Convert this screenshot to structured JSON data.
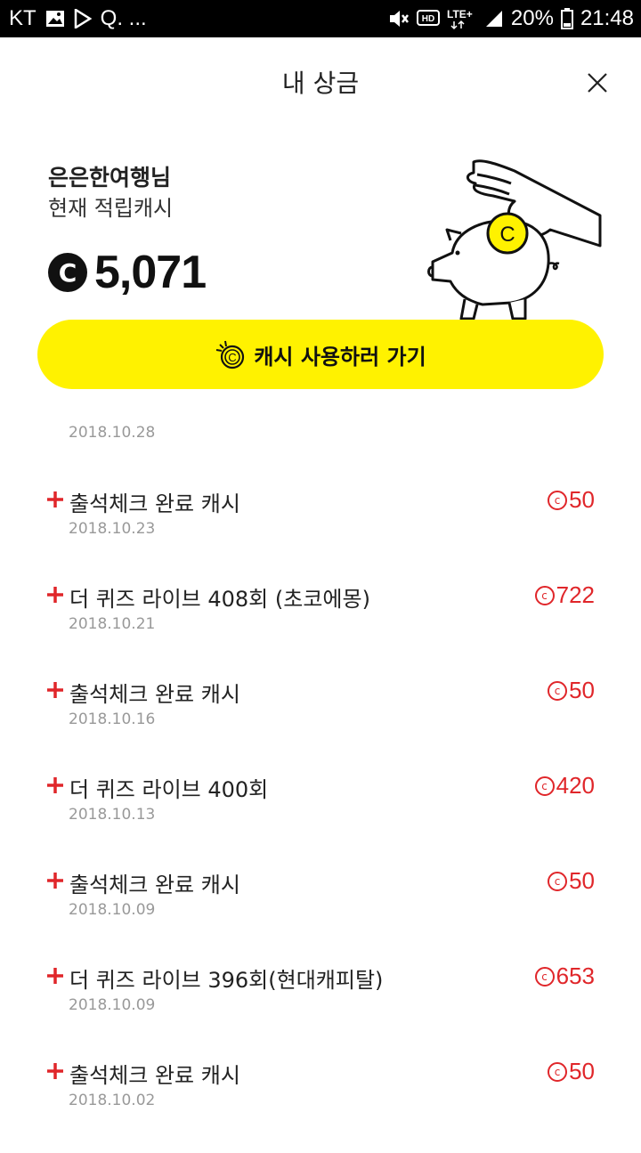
{
  "status_bar": {
    "carrier": "KT",
    "extra": "Q. ...",
    "battery": "20%",
    "time": "21:48"
  },
  "header": {
    "title": "내 상금"
  },
  "summary": {
    "user_name": "은은한여행님",
    "cash_label": "현재 적립캐시",
    "coin_symbol": "C",
    "balance": "5,071"
  },
  "cta": {
    "label": "캐시 사용하러 가기"
  },
  "top_date": "2018.10.28",
  "history": [
    {
      "title": "출석체크 완료 캐시",
      "date": "2018.10.23",
      "amount": "50"
    },
    {
      "title": "더 퀴즈 라이브 408회 (초코에몽)",
      "date": "2018.10.21",
      "amount": "722"
    },
    {
      "title": "출석체크 완료 캐시",
      "date": "2018.10.16",
      "amount": "50"
    },
    {
      "title": "더 퀴즈 라이브 400회",
      "date": "2018.10.13",
      "amount": "420"
    },
    {
      "title": "출석체크 완료 캐시",
      "date": "2018.10.09",
      "amount": "50"
    },
    {
      "title": "더 퀴즈 라이브 396회(현대캐피탈)",
      "date": "2018.10.09",
      "amount": "653"
    },
    {
      "title": "출석체크 완료 캐시",
      "date": "2018.10.02",
      "amount": "50"
    }
  ],
  "colors": {
    "accent_yellow": "#fff200",
    "amount_red": "#e0262a",
    "date_gray": "#999999"
  },
  "icons": [
    "gallery-icon",
    "play-store-icon",
    "mute-icon",
    "hd-icon",
    "lte-icon",
    "signal-icon",
    "battery-icon",
    "close-icon",
    "piggy-bank-illustration",
    "coin-icon",
    "plus-icon"
  ]
}
